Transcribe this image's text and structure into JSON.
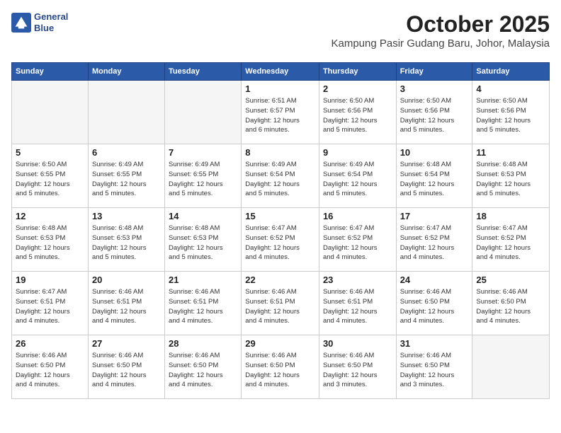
{
  "header": {
    "logo_line1": "General",
    "logo_line2": "Blue",
    "month_title": "October 2025",
    "location": "Kampung Pasir Gudang Baru, Johor, Malaysia"
  },
  "weekdays": [
    "Sunday",
    "Monday",
    "Tuesday",
    "Wednesday",
    "Thursday",
    "Friday",
    "Saturday"
  ],
  "weeks": [
    [
      {
        "day": "",
        "info": ""
      },
      {
        "day": "",
        "info": ""
      },
      {
        "day": "",
        "info": ""
      },
      {
        "day": "1",
        "info": "Sunrise: 6:51 AM\nSunset: 6:57 PM\nDaylight: 12 hours\nand 6 minutes."
      },
      {
        "day": "2",
        "info": "Sunrise: 6:50 AM\nSunset: 6:56 PM\nDaylight: 12 hours\nand 5 minutes."
      },
      {
        "day": "3",
        "info": "Sunrise: 6:50 AM\nSunset: 6:56 PM\nDaylight: 12 hours\nand 5 minutes."
      },
      {
        "day": "4",
        "info": "Sunrise: 6:50 AM\nSunset: 6:56 PM\nDaylight: 12 hours\nand 5 minutes."
      }
    ],
    [
      {
        "day": "5",
        "info": "Sunrise: 6:50 AM\nSunset: 6:55 PM\nDaylight: 12 hours\nand 5 minutes."
      },
      {
        "day": "6",
        "info": "Sunrise: 6:49 AM\nSunset: 6:55 PM\nDaylight: 12 hours\nand 5 minutes."
      },
      {
        "day": "7",
        "info": "Sunrise: 6:49 AM\nSunset: 6:55 PM\nDaylight: 12 hours\nand 5 minutes."
      },
      {
        "day": "8",
        "info": "Sunrise: 6:49 AM\nSunset: 6:54 PM\nDaylight: 12 hours\nand 5 minutes."
      },
      {
        "day": "9",
        "info": "Sunrise: 6:49 AM\nSunset: 6:54 PM\nDaylight: 12 hours\nand 5 minutes."
      },
      {
        "day": "10",
        "info": "Sunrise: 6:48 AM\nSunset: 6:54 PM\nDaylight: 12 hours\nand 5 minutes."
      },
      {
        "day": "11",
        "info": "Sunrise: 6:48 AM\nSunset: 6:53 PM\nDaylight: 12 hours\nand 5 minutes."
      }
    ],
    [
      {
        "day": "12",
        "info": "Sunrise: 6:48 AM\nSunset: 6:53 PM\nDaylight: 12 hours\nand 5 minutes."
      },
      {
        "day": "13",
        "info": "Sunrise: 6:48 AM\nSunset: 6:53 PM\nDaylight: 12 hours\nand 5 minutes."
      },
      {
        "day": "14",
        "info": "Sunrise: 6:48 AM\nSunset: 6:53 PM\nDaylight: 12 hours\nand 5 minutes."
      },
      {
        "day": "15",
        "info": "Sunrise: 6:47 AM\nSunset: 6:52 PM\nDaylight: 12 hours\nand 4 minutes."
      },
      {
        "day": "16",
        "info": "Sunrise: 6:47 AM\nSunset: 6:52 PM\nDaylight: 12 hours\nand 4 minutes."
      },
      {
        "day": "17",
        "info": "Sunrise: 6:47 AM\nSunset: 6:52 PM\nDaylight: 12 hours\nand 4 minutes."
      },
      {
        "day": "18",
        "info": "Sunrise: 6:47 AM\nSunset: 6:52 PM\nDaylight: 12 hours\nand 4 minutes."
      }
    ],
    [
      {
        "day": "19",
        "info": "Sunrise: 6:47 AM\nSunset: 6:51 PM\nDaylight: 12 hours\nand 4 minutes."
      },
      {
        "day": "20",
        "info": "Sunrise: 6:46 AM\nSunset: 6:51 PM\nDaylight: 12 hours\nand 4 minutes."
      },
      {
        "day": "21",
        "info": "Sunrise: 6:46 AM\nSunset: 6:51 PM\nDaylight: 12 hours\nand 4 minutes."
      },
      {
        "day": "22",
        "info": "Sunrise: 6:46 AM\nSunset: 6:51 PM\nDaylight: 12 hours\nand 4 minutes."
      },
      {
        "day": "23",
        "info": "Sunrise: 6:46 AM\nSunset: 6:51 PM\nDaylight: 12 hours\nand 4 minutes."
      },
      {
        "day": "24",
        "info": "Sunrise: 6:46 AM\nSunset: 6:50 PM\nDaylight: 12 hours\nand 4 minutes."
      },
      {
        "day": "25",
        "info": "Sunrise: 6:46 AM\nSunset: 6:50 PM\nDaylight: 12 hours\nand 4 minutes."
      }
    ],
    [
      {
        "day": "26",
        "info": "Sunrise: 6:46 AM\nSunset: 6:50 PM\nDaylight: 12 hours\nand 4 minutes."
      },
      {
        "day": "27",
        "info": "Sunrise: 6:46 AM\nSunset: 6:50 PM\nDaylight: 12 hours\nand 4 minutes."
      },
      {
        "day": "28",
        "info": "Sunrise: 6:46 AM\nSunset: 6:50 PM\nDaylight: 12 hours\nand 4 minutes."
      },
      {
        "day": "29",
        "info": "Sunrise: 6:46 AM\nSunset: 6:50 PM\nDaylight: 12 hours\nand 4 minutes."
      },
      {
        "day": "30",
        "info": "Sunrise: 6:46 AM\nSunset: 6:50 PM\nDaylight: 12 hours\nand 3 minutes."
      },
      {
        "day": "31",
        "info": "Sunrise: 6:46 AM\nSunset: 6:50 PM\nDaylight: 12 hours\nand 3 minutes."
      },
      {
        "day": "",
        "info": ""
      }
    ]
  ]
}
